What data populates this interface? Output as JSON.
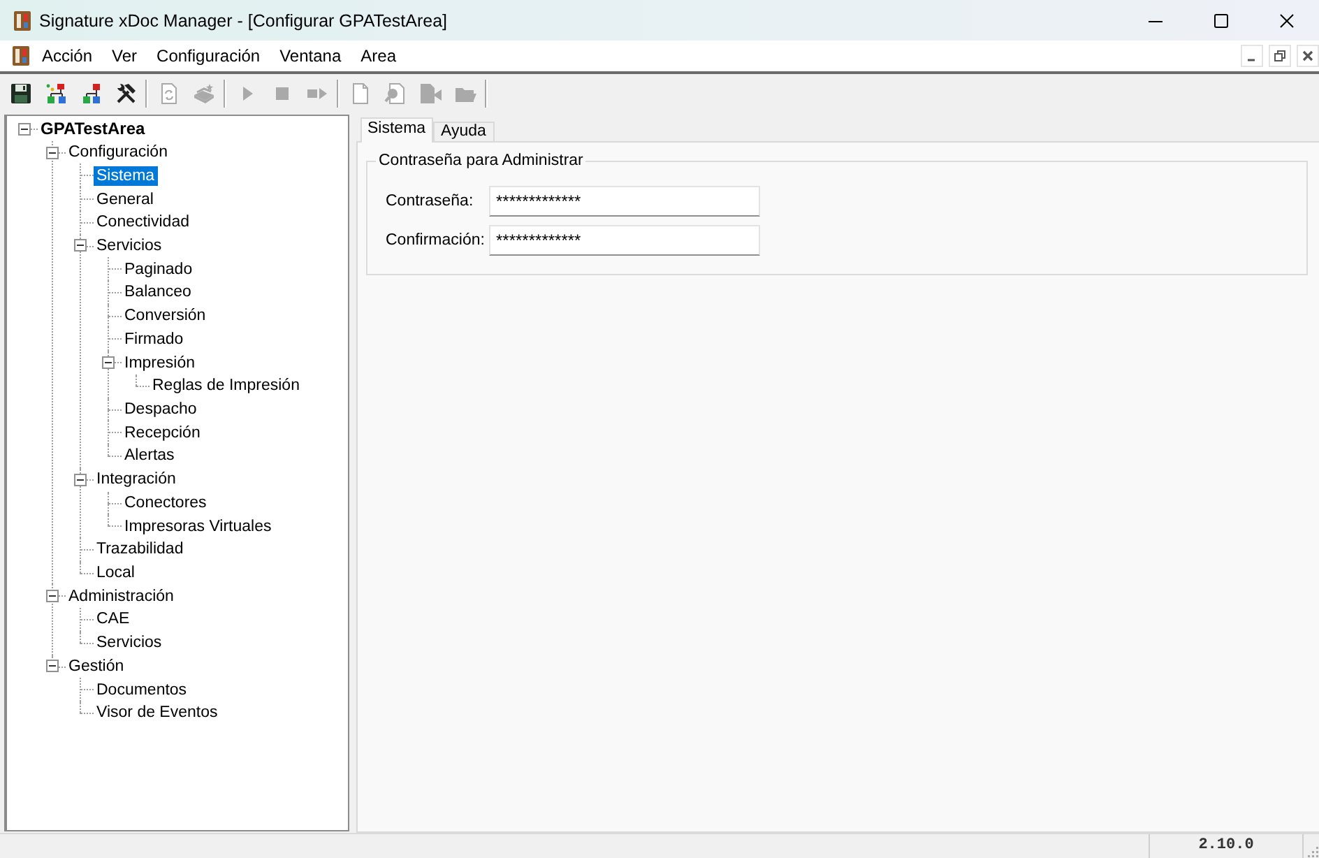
{
  "window": {
    "title": "Signature xDoc Manager - [Configurar GPATestArea]"
  },
  "menu_bar": {
    "items": [
      "Acción",
      "Ver",
      "Configuración",
      "Ventana",
      "Area"
    ]
  },
  "toolbar": {
    "groups": [
      [
        {
          "disabled": false
        },
        {
          "disabled": false
        },
        {
          "disabled": false
        },
        {
          "disabled": false
        }
      ],
      [
        {
          "disabled": true
        },
        {
          "disabled": true
        }
      ],
      [
        {
          "disabled": true
        },
        {
          "disabled": true
        },
        {
          "disabled": true
        }
      ],
      [
        {
          "disabled": true
        },
        {
          "disabled": true
        },
        {
          "disabled": true
        },
        {
          "disabled": true
        }
      ]
    ]
  },
  "tree": [
    {
      "label": "GPATestArea",
      "selected": false,
      "expanded": true,
      "children": [
        {
          "label": "Configuración",
          "selected": false,
          "expanded": true,
          "children": [
            {
              "label": "Sistema",
              "selected": true
            },
            {
              "label": "General",
              "selected": false
            },
            {
              "label": "Conectividad",
              "selected": false
            },
            {
              "label": "Servicios",
              "selected": false,
              "expanded": true,
              "children": [
                {
                  "label": "Paginado",
                  "selected": false
                },
                {
                  "label": "Balanceo",
                  "selected": false
                },
                {
                  "label": "Conversión",
                  "selected": false
                },
                {
                  "label": "Firmado",
                  "selected": false
                },
                {
                  "label": "Impresión",
                  "selected": false,
                  "expanded": true,
                  "children": [
                    {
                      "label": "Reglas de Impresión",
                      "selected": false
                    }
                  ]
                },
                {
                  "label": "Despacho",
                  "selected": false
                },
                {
                  "label": "Recepción",
                  "selected": false
                },
                {
                  "label": "Alertas",
                  "selected": false
                }
              ]
            },
            {
              "label": "Integración",
              "selected": false,
              "expanded": true,
              "children": [
                {
                  "label": "Conectores",
                  "selected": false
                },
                {
                  "label": "Impresoras Virtuales",
                  "selected": false
                }
              ]
            },
            {
              "label": "Trazabilidad",
              "selected": false
            },
            {
              "label": "Local",
              "selected": false
            }
          ]
        },
        {
          "label": "Administración",
          "selected": false,
          "expanded": true,
          "children": [
            {
              "label": "CAE",
              "selected": false
            },
            {
              "label": "Servicios",
              "selected": false
            }
          ]
        },
        {
          "label": "Gestión",
          "selected": false,
          "expanded": true,
          "children": [
            {
              "label": "Documentos",
              "selected": false
            },
            {
              "label": "Visor de Eventos",
              "selected": false
            }
          ]
        }
      ]
    }
  ],
  "tabs": [
    {
      "label": "Sistema",
      "selected": true
    },
    {
      "label": "Ayuda",
      "selected": false
    }
  ],
  "group_box": {
    "title": "Contraseña para Administrar",
    "fields": [
      {
        "label": "Contraseña:",
        "value": "*************"
      },
      {
        "label": "Confirmación:",
        "value": "*************"
      }
    ]
  },
  "status_bar": {
    "version": "2.10.0"
  }
}
